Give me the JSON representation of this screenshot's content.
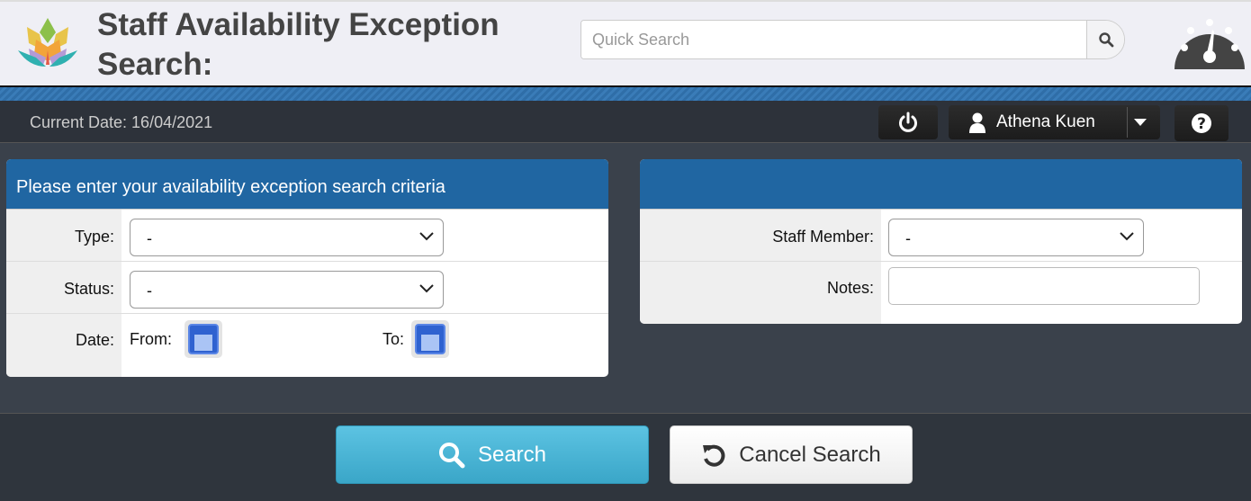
{
  "header": {
    "title": "Staff Availability Exception Search:",
    "quick_search_placeholder": "Quick Search"
  },
  "topbar": {
    "current_date": "Current Date: 16/04/2021",
    "user_name": "Athena Kuen"
  },
  "left_panel": {
    "heading": "Please enter your availability exception search criteria",
    "type_label": "Type:",
    "type_value": "-",
    "status_label": "Status:",
    "status_value": "-",
    "date_label": "Date:",
    "from_label": "From:",
    "to_label": "To:"
  },
  "right_panel": {
    "staff_label": "Staff Member:",
    "staff_value": "-",
    "notes_label": "Notes:",
    "notes_value": ""
  },
  "actions": {
    "search": "Search",
    "cancel": "Cancel Search"
  },
  "colors": {
    "panel_header": "#2066a2",
    "search_button": "#4cb6d6"
  }
}
